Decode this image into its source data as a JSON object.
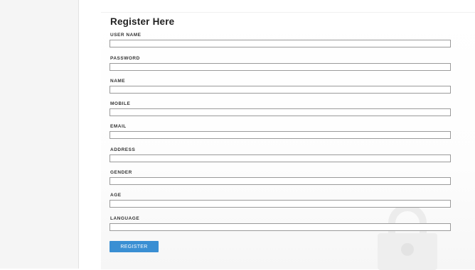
{
  "form": {
    "title": "Register Here",
    "fields": [
      {
        "label": "USER NAME",
        "value": ""
      },
      {
        "label": "PASSWORD",
        "value": ""
      },
      {
        "label": "NAME",
        "value": ""
      },
      {
        "label": "MOBILE",
        "value": ""
      },
      {
        "label": "EMAIL",
        "value": ""
      },
      {
        "label": "ADDRESS",
        "value": ""
      },
      {
        "label": "GENDER",
        "value": ""
      },
      {
        "label": "AGE",
        "value": ""
      },
      {
        "label": "LANGUAGE",
        "value": ""
      }
    ],
    "submit_label": "REGISTER"
  },
  "colors": {
    "button": "#3a8fd3",
    "field_border": "#9a9a9a",
    "sidebar": "#f5f5f5"
  },
  "icons": {
    "background_watermark": "padlock-icon"
  }
}
